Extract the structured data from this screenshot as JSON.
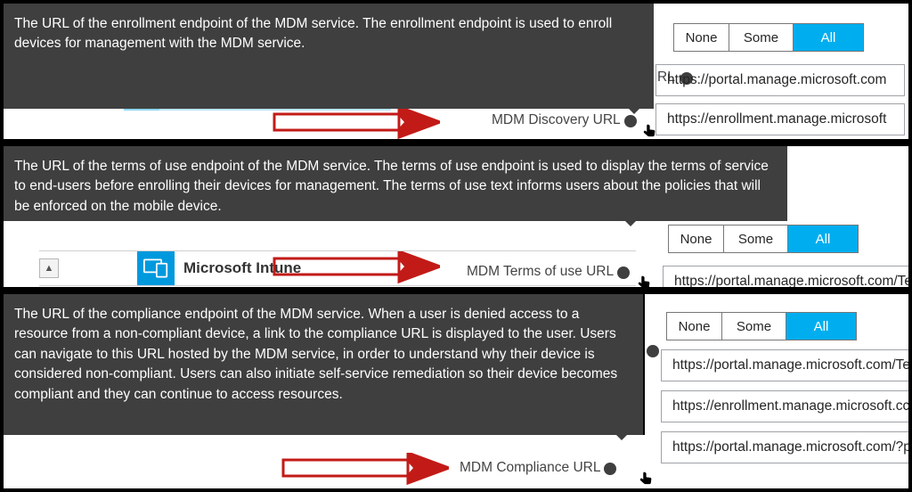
{
  "common": {
    "seg_none": "None",
    "seg_some": "Some",
    "seg_all": "All",
    "info_icon": "info-icon",
    "hand_icon": "hand-pointer-icon",
    "arrow_icon": "red-arrow-annotation"
  },
  "panel1": {
    "tooltip_text": "The URL of the enrollment endpoint of the MDM service. The enrollment endpoint is used to enroll devices for management with the MDM service.",
    "trailing_label": "RL",
    "field_label": "MDM Discovery URL",
    "url_a": "https://portal.manage.microsoft.com",
    "url_b": "https://enrollment.manage.microsoft"
  },
  "panel2": {
    "tooltip_text": "The URL of the terms of use endpoint of the MDM service. The terms of use endpoint is used to display the terms of service to end-users before enrolling their devices for management. The terms of use text informs users about the policies that will be enforced on the mobile device.",
    "intune_label": "Microsoft Intune",
    "field_label": "MDM Terms of use URL",
    "url_a": "https://portal.manage.microsoft.com/Te"
  },
  "panel3": {
    "tooltip_text": "The URL of the compliance endpoint of the MDM service. When a user is denied access to a resource from a non-compliant device, a link to the compliance URL is displayed to the user. Users can navigate to this URL hosted by the MDM service, in order to understand why their device is considered non-compliant. Users can also initiate self-service remediation so their device becomes compliant and they can continue to access resources.",
    "field_label": "MDM Compliance URL",
    "url_a": "https://portal.manage.microsoft.com/Te",
    "url_b": "https://enrollment.manage.microsoft.cc",
    "url_c": "https://portal.manage.microsoft.com/?p"
  }
}
